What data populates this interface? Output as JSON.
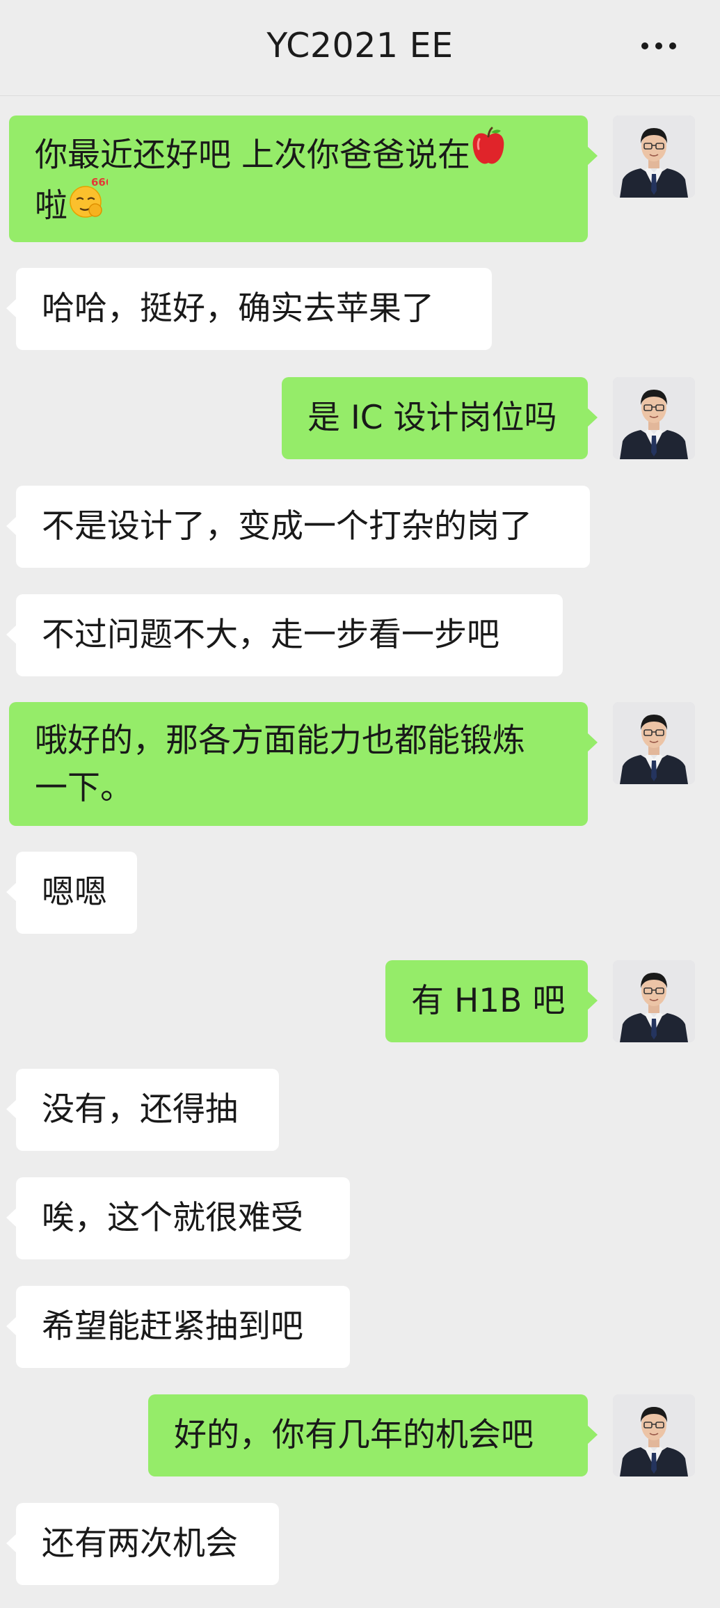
{
  "header": {
    "title": "YC2021 EE",
    "more_icon": "more-horizontal-icon"
  },
  "messages": [
    {
      "from": "me",
      "line1": "你最近还好吧 上次你爸爸说在",
      "emoji1": "red-apple-icon",
      "line2": "啦",
      "emoji2": "666-emoji-icon"
    },
    {
      "from": "other",
      "text": "哈哈，挺好，确实去苹果了"
    },
    {
      "from": "me",
      "text": "是 IC 设计岗位吗"
    },
    {
      "from": "other",
      "text": "不是设计了，变成一个打杂的岗了"
    },
    {
      "from": "other",
      "text": "不过问题不大，走一步看一步吧"
    },
    {
      "from": "me",
      "line1": "哦好的，那各方面能力也都能锻炼",
      "line2": "一下。"
    },
    {
      "from": "other",
      "text": "嗯嗯"
    },
    {
      "from": "me",
      "text": "有 H1B 吧"
    },
    {
      "from": "other",
      "text": "没有，还得抽"
    },
    {
      "from": "other",
      "text": "唉，这个就很难受"
    },
    {
      "from": "other",
      "text": "希望能赶紧抽到吧"
    },
    {
      "from": "me",
      "text": "好的，你有几年的机会吧"
    },
    {
      "from": "other",
      "text": "还有两次机会"
    }
  ],
  "emoji_badge": "666",
  "colors": {
    "background": "#ededed",
    "my_bubble": "#95ec69",
    "other_bubble": "#ffffff",
    "text": "#191919"
  }
}
